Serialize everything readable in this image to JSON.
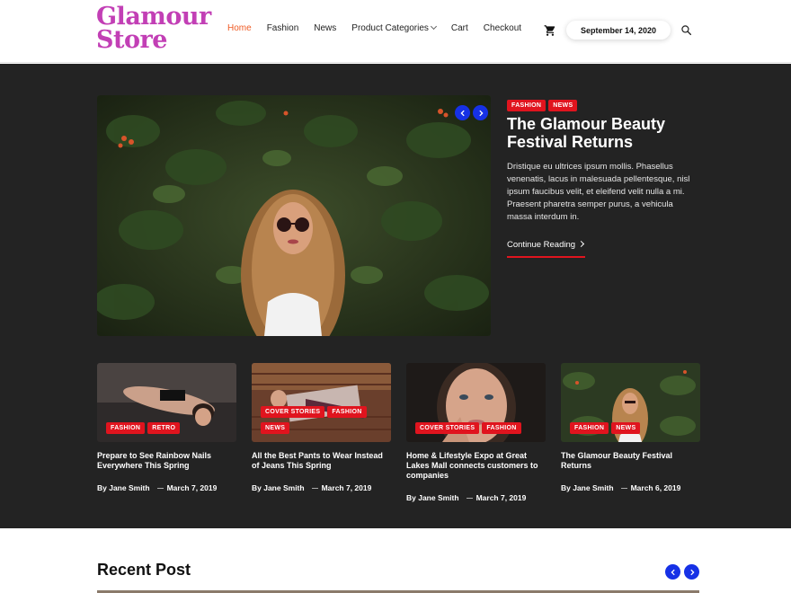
{
  "brand": {
    "line1": "Glamour",
    "line2": "Store",
    "color": "#c23fb5"
  },
  "nav": {
    "items": [
      {
        "label": "Home",
        "active": true
      },
      {
        "label": "Fashion"
      },
      {
        "label": "News"
      },
      {
        "label": "Product Categories",
        "dropdown": true
      },
      {
        "label": "Cart"
      },
      {
        "label": "Checkout"
      }
    ]
  },
  "header": {
    "date": "September 14, 2020",
    "cart_icon": "cart-icon",
    "search_icon": "search-icon"
  },
  "hero": {
    "tags": [
      "FASHION",
      "NEWS"
    ],
    "title": "The Glamour Beauty Festival Returns",
    "excerpt": "Dristique eu ultrices ipsum mollis. Phasellus venenatis, lacus in malesuada pellentesque, nisl ipsum faucibus velit, et eleifend velit nulla a mi. Praesent pharetra semper purus, a vehicula massa interdum in.",
    "read_more": "Continue Reading"
  },
  "cards": [
    {
      "tags": [
        "FASHION",
        "RETRO"
      ],
      "title": "Prepare to See Rainbow Nails Everywhere This Spring",
      "author": "By Jane Smith",
      "date": "March 7, 2019"
    },
    {
      "tags": [
        "COVER STORIES",
        "FASHION",
        "NEWS"
      ],
      "title": "All the Best Pants to Wear Instead of Jeans This Spring",
      "author": "By Jane Smith",
      "date": "March 7, 2019"
    },
    {
      "tags": [
        "COVER STORIES",
        "FASHION"
      ],
      "title": "Home & Lifestyle Expo at Great Lakes Mall connects customers to companies",
      "author": "By Jane Smith",
      "date": "March 7, 2019"
    },
    {
      "tags": [
        "FASHION",
        "NEWS"
      ],
      "title": "The Glamour Beauty Festival Returns",
      "author": "By Jane Smith",
      "date": "March 6, 2019"
    }
  ],
  "recent": {
    "title": "Recent Post"
  },
  "colors": {
    "accent": "#ef5b25",
    "tag": "#e0141e",
    "slider_button": "#1631e6",
    "dark_bg": "#232323"
  }
}
